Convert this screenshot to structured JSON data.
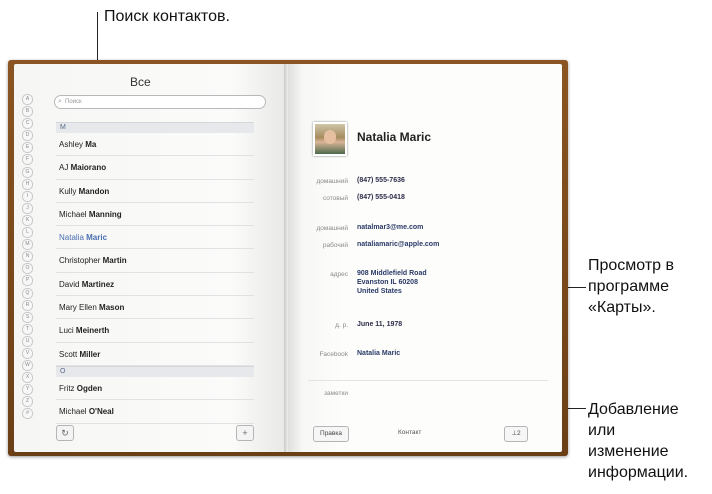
{
  "callouts": {
    "search": "Поиск контактов.",
    "maps_1": "Просмотр в",
    "maps_2": "программе",
    "maps_3": "«Карты».",
    "edit_1": "Добавление",
    "edit_2": "или",
    "edit_3": "изменение",
    "edit_4": "информации."
  },
  "left_page": {
    "title": "Все",
    "search_placeholder": "Поиск",
    "alphabet": [
      "A",
      "B",
      "C",
      "D",
      "E",
      "F",
      "G",
      "H",
      "I",
      "J",
      "K",
      "L",
      "M",
      "N",
      "O",
      "P",
      "Q",
      "R",
      "S",
      "T",
      "U",
      "V",
      "W",
      "X",
      "Y",
      "Z",
      "#"
    ],
    "section_m": "M",
    "section_o": "O",
    "contacts_m": [
      {
        "first": "Ashley",
        "last": "Ma",
        "selected": false
      },
      {
        "first": "AJ",
        "last": "Maiorano",
        "selected": false
      },
      {
        "first": "Kully",
        "last": "Mandon",
        "selected": false
      },
      {
        "first": "Michael",
        "last": "Manning",
        "selected": false
      },
      {
        "first": "Natalia",
        "last": "Maric",
        "selected": true
      },
      {
        "first": "Christopher",
        "last": "Martin",
        "selected": false
      },
      {
        "first": "David",
        "last": "Martinez",
        "selected": false
      },
      {
        "first": "Mary Ellen",
        "last": "Mason",
        "selected": false
      },
      {
        "first": "Luci",
        "last": "Meinerth",
        "selected": false
      },
      {
        "first": "Scott",
        "last": "Miller",
        "selected": false
      }
    ],
    "contacts_o": [
      {
        "first": "Fritz",
        "last": "Ogden",
        "selected": false
      },
      {
        "first": "Michael",
        "last": "O'Neal",
        "selected": false
      }
    ],
    "refresh_icon": "refresh-icon",
    "add_label": "+"
  },
  "contact": {
    "name": "Natalia Maric",
    "home_phone_label": "домашний",
    "home_phone": "(847) 555-7636",
    "mobile_label": "сотовый",
    "mobile": "(847) 555-0418",
    "home_email_label": "домашний",
    "home_email": "natalmar3@me.com",
    "work_email_label": "рабочий",
    "work_email": "nataliamaric@apple.com",
    "address_label": "адрес",
    "address_1": "908 Middlefield Road",
    "address_2": "Evanston IL 60208",
    "address_3": "United States",
    "birthday_label": "д. р.",
    "birthday": "June 11, 1978",
    "facebook_label": "Facebook",
    "facebook": "Natalia Maric",
    "notes_label": "заметки",
    "edit_button": "Правка",
    "footer_title": "Контакт",
    "share_button": "⊥2"
  }
}
